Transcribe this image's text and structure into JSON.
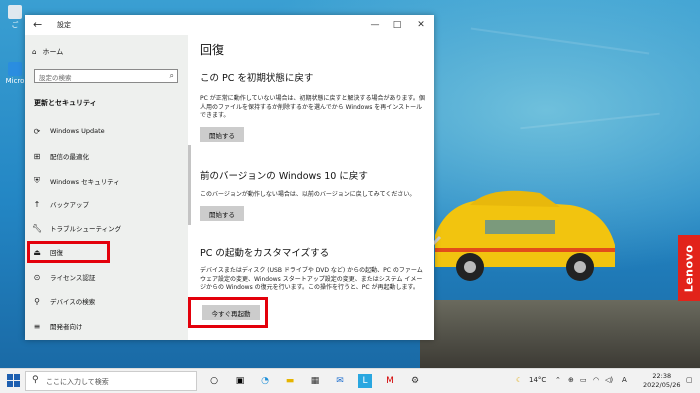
{
  "window": {
    "title": "設定",
    "back_glyph": "←",
    "controls": {
      "minimize": "—",
      "maximize": "□",
      "close": "✕"
    }
  },
  "sidebar": {
    "home": "ホーム",
    "search_placeholder": "設定の検索",
    "section": "更新とセキュリティ",
    "items": [
      {
        "label": "Windows Update",
        "icon": "sync-icon"
      },
      {
        "label": "配信の最適化",
        "icon": "delivery-icon"
      },
      {
        "label": "Windows セキュリティ",
        "icon": "shield-icon"
      },
      {
        "label": "バックアップ",
        "icon": "backup-icon"
      },
      {
        "label": "トラブルシューティング",
        "icon": "wrench-icon"
      },
      {
        "label": "回復",
        "icon": "recovery-icon",
        "selected": true
      },
      {
        "label": "ライセンス認証",
        "icon": "check-circle-icon"
      },
      {
        "label": "デバイスの検索",
        "icon": "person-pin-icon"
      },
      {
        "label": "開発者向け",
        "icon": "developer-icon"
      }
    ]
  },
  "content": {
    "title": "回復",
    "sections": [
      {
        "heading": "この PC を初期状態に戻す",
        "text": "PC が正常に動作していない場合は、初期状態に戻すと解決する場合があります。個人用のファイルを保持するか削除するかを選んでから Windows を再インストールできます。",
        "button": "開始する"
      },
      {
        "heading": "前のバージョンの Windows 10 に戻す",
        "text": "このバージョンが動作しない場合は、以前のバージョンに戻してみてください。",
        "button": "開始する"
      },
      {
        "heading": "PC の起動をカスタマイズする",
        "text": "デバイスまたはディスク (USB ドライブや DVD など) からの起動、PC のファームウェア設定の変更、Windows スタートアップ設定の変更、またはシステム イメージからの Windows の復元を行います。この操作を行うと、PC が再起動します。",
        "button": "今すぐ再起動"
      }
    ]
  },
  "desktop": {
    "icons": [
      "ご",
      "Micro"
    ],
    "brand": "Lenovo"
  },
  "taskbar": {
    "search_placeholder": "ここに入力して検索",
    "weather": "14°C",
    "ime": "A",
    "time": "22:38",
    "date": "2022/05/26"
  },
  "colors": {
    "highlight": "#e3000b",
    "accent": "#0078d7"
  }
}
